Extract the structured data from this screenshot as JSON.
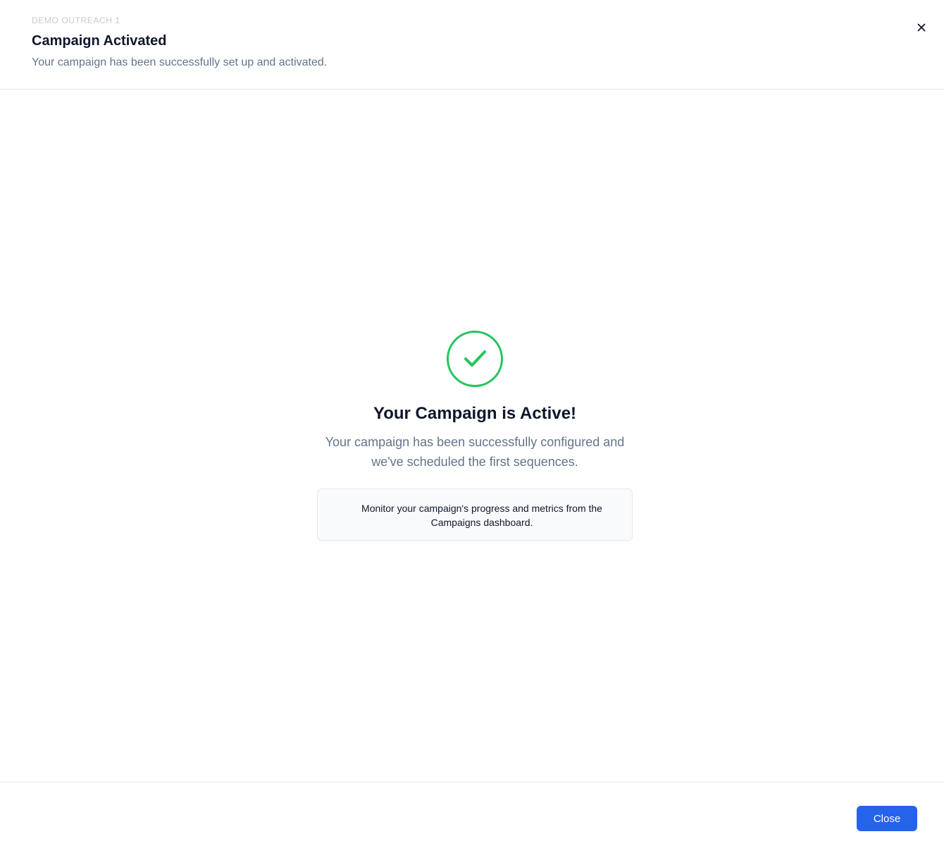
{
  "header": {
    "eyebrow": "DEMO OUTREACH 1",
    "title": "Campaign Activated",
    "subtitle": "Your campaign has been successfully set up and activated.",
    "close_icon": "close-icon"
  },
  "main": {
    "status_icon": "check-circle-icon",
    "headline": "Your Campaign is Active!",
    "description": "Your campaign has been successfully configured and we've scheduled the first sequences.",
    "info_text": "Monitor your campaign's progress and metrics from the Campaigns dashboard."
  },
  "footer": {
    "close_label": "Close"
  },
  "colors": {
    "success": "#22c55e",
    "primary": "#2563eb",
    "muted_text": "#64748b",
    "eyebrow": "#c4c9d2"
  }
}
